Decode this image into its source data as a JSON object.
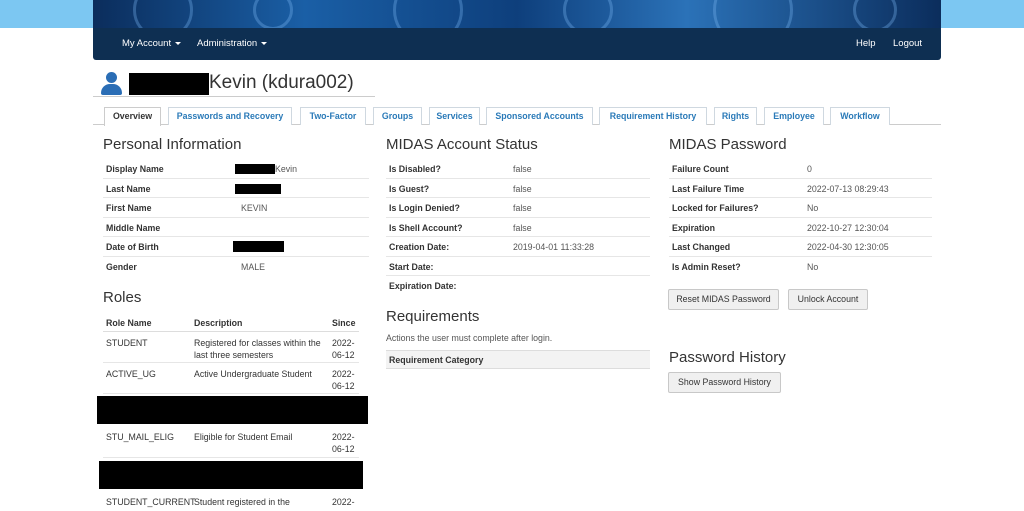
{
  "nav": {
    "my_account": "My Account",
    "administration": "Administration",
    "help": "Help",
    "logout": "Logout"
  },
  "user": {
    "title": "Kevin (kdura002)"
  },
  "tabs": [
    {
      "label": "Overview",
      "active": true
    },
    {
      "label": "Passwords and Recovery"
    },
    {
      "label": "Two-Factor"
    },
    {
      "label": "Groups"
    },
    {
      "label": "Services"
    },
    {
      "label": "Sponsored Accounts"
    },
    {
      "label": "Requirement History"
    },
    {
      "label": "Rights"
    },
    {
      "label": "Employee"
    },
    {
      "label": "Workflow"
    }
  ],
  "personal": {
    "title": "Personal Information",
    "rows": [
      {
        "label": "Display Name",
        "value": "Kevin"
      },
      {
        "label": "Last Name",
        "value": ""
      },
      {
        "label": "First Name",
        "value": "KEVIN"
      },
      {
        "label": "Middle Name",
        "value": ""
      },
      {
        "label": "Date of Birth",
        "value": ""
      },
      {
        "label": "Gender",
        "value": "MALE"
      }
    ]
  },
  "status": {
    "title": "MIDAS Account Status",
    "rows": [
      {
        "label": "Is Disabled?",
        "value": "false"
      },
      {
        "label": "Is Guest?",
        "value": "false"
      },
      {
        "label": "Is Login Denied?",
        "value": "false"
      },
      {
        "label": "Is Shell Account?",
        "value": "false"
      },
      {
        "label": "Creation Date:",
        "value": "2019-04-01 11:33:28"
      },
      {
        "label": "Start Date:",
        "value": ""
      },
      {
        "label": "Expiration Date:",
        "value": ""
      }
    ]
  },
  "password": {
    "title": "MIDAS Password",
    "rows": [
      {
        "label": "Failure Count",
        "value": "0"
      },
      {
        "label": "Last Failure Time",
        "value": "2022-07-13 08:29:43"
      },
      {
        "label": "Locked for Failures?",
        "value": "No"
      },
      {
        "label": "Expiration",
        "value": "2022-10-27 12:30:04"
      },
      {
        "label": "Last Changed",
        "value": "2022-04-30 12:30:05"
      },
      {
        "label": "Is Admin Reset?",
        "value": "No"
      }
    ],
    "reset_button": "Reset MIDAS Password",
    "unlock_button": "Unlock Account"
  },
  "history": {
    "title": "Password History",
    "show_button": "Show Password History"
  },
  "requirements": {
    "title": "Requirements",
    "subtitle": "Actions the user must complete after login.",
    "column": "Requirement Category"
  },
  "roles": {
    "title": "Roles",
    "headers": {
      "name": "Role Name",
      "description": "Description",
      "since": "Since"
    },
    "rows": [
      {
        "name": "STUDENT",
        "desc1": "Registered for classes within the",
        "desc2": "last three semesters",
        "since1": "2022-",
        "since2": "06-12"
      },
      {
        "name": "ACTIVE_UG",
        "desc1": "Active Undergraduate Student",
        "desc2": "",
        "since1": "2022-",
        "since2": "06-12"
      },
      {
        "name": "STU_MAIL_ELIG",
        "desc1": "Eligible for Student Email",
        "desc2": "",
        "since1": "2022-",
        "since2": "06-12"
      },
      {
        "name": "STUDENT_CURRENT",
        "desc1": "Student registered in the",
        "desc2": "",
        "since1": "2022-",
        "since2": ""
      }
    ]
  }
}
